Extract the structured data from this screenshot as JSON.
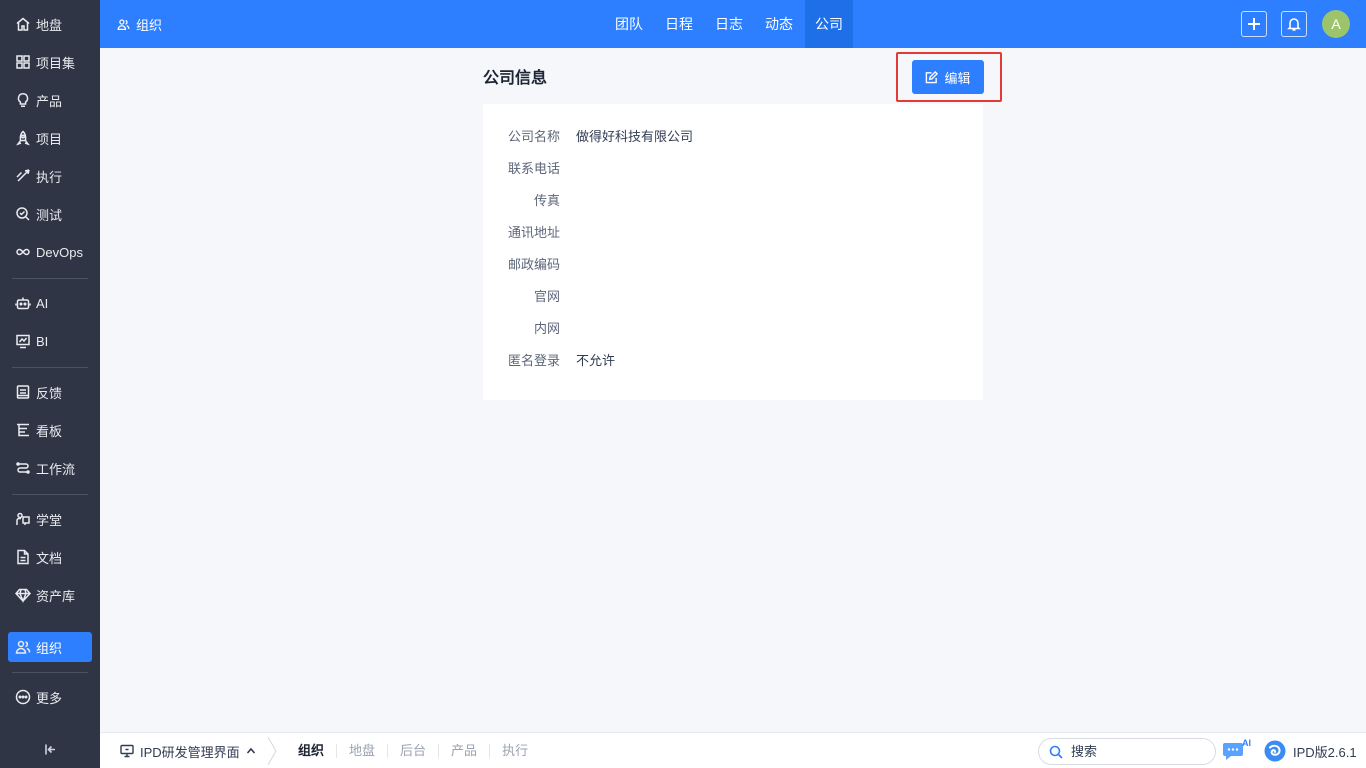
{
  "sidebar": {
    "items": [
      {
        "label": "地盘",
        "icon": "home-icon"
      },
      {
        "label": "项目集",
        "icon": "grid-icon"
      },
      {
        "label": "产品",
        "icon": "bulb-icon"
      },
      {
        "label": "项目",
        "icon": "rocket-icon"
      },
      {
        "label": "执行",
        "icon": "run-icon"
      },
      {
        "label": "测试",
        "icon": "test-icon"
      },
      {
        "label": "DevOps",
        "icon": "infinity-icon"
      },
      {
        "label": "AI",
        "icon": "robot-icon"
      },
      {
        "label": "BI",
        "icon": "chart-icon"
      },
      {
        "label": "反馈",
        "icon": "feedback-icon"
      },
      {
        "label": "看板",
        "icon": "kanban-icon"
      },
      {
        "label": "工作流",
        "icon": "workflow-icon"
      },
      {
        "label": "学堂",
        "icon": "school-icon"
      },
      {
        "label": "文档",
        "icon": "doc-icon"
      },
      {
        "label": "资产库",
        "icon": "diamond-icon"
      },
      {
        "label": "组织",
        "icon": "users-icon"
      },
      {
        "label": "更多",
        "icon": "more-icon"
      }
    ],
    "active": "组织",
    "active_color": "#2e7fff",
    "background": "#2f3544"
  },
  "header": {
    "title": "组织",
    "tabs": [
      "团队",
      "日程",
      "日志",
      "动态",
      "公司"
    ],
    "active_tab": "公司",
    "avatar_letter": "A",
    "color": "#2e7fff"
  },
  "page": {
    "title": "公司信息",
    "edit_label": "编辑",
    "fields": [
      {
        "label": "公司名称",
        "value": "做得好科技有限公司"
      },
      {
        "label": "联系电话",
        "value": ""
      },
      {
        "label": "传真",
        "value": ""
      },
      {
        "label": "通讯地址",
        "value": ""
      },
      {
        "label": "邮政编码",
        "value": ""
      },
      {
        "label": "官网",
        "value": ""
      },
      {
        "label": "内网",
        "value": ""
      },
      {
        "label": "匿名登录",
        "value": "不允许"
      }
    ],
    "highlight_color": "#e53935"
  },
  "footer": {
    "app_switch": "IPD研发管理界面",
    "breadcrumbs": [
      "组织",
      "地盘",
      "后台",
      "产品",
      "执行"
    ],
    "active_crumb": "组织",
    "search_placeholder": "搜索",
    "ai_tag": "AI",
    "version": "IPD版2.6.1"
  }
}
